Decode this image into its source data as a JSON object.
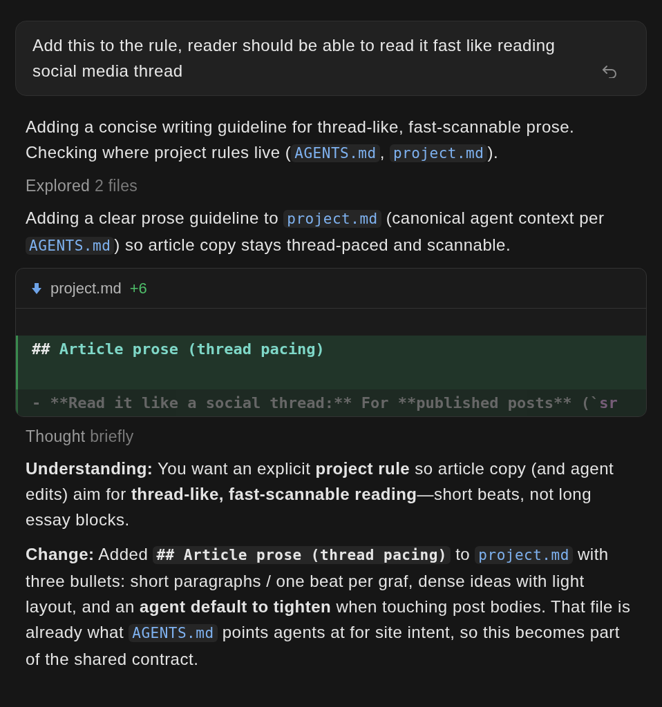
{
  "user_message": {
    "text": "Add this to the rule, reader should be able to read it fast like reading social media thread"
  },
  "blocks": [
    {
      "kind": "paragraph",
      "segments": [
        {
          "kind": "text",
          "text": "Adding a concise writing guideline for thread-like, fast-scannable prose. Checking where project rules live ("
        },
        {
          "kind": "code",
          "text": "AGENTS.md"
        },
        {
          "kind": "text",
          "text": ", "
        },
        {
          "kind": "code",
          "text": "project.md"
        },
        {
          "kind": "text",
          "text": ")."
        }
      ]
    },
    {
      "kind": "status",
      "label": "Explored",
      "detail": "2 files"
    },
    {
      "kind": "paragraph",
      "segments": [
        {
          "kind": "text",
          "text": "Adding a clear prose guideline to "
        },
        {
          "kind": "code",
          "text": "project.md"
        },
        {
          "kind": "text",
          "text": " (canonical agent context per "
        },
        {
          "kind": "code",
          "text": "AGENTS.md"
        },
        {
          "kind": "text",
          "text": ") so article copy stays thread-paced and scannable."
        }
      ]
    },
    {
      "kind": "diff",
      "file": "project.md",
      "added_count": "+6",
      "lines": [
        {
          "added": false
        },
        {
          "added": true,
          "segments": [
            {
              "kind": "marker",
              "text": "## "
            },
            {
              "kind": "heading",
              "text": "Article prose (thread pacing)"
            }
          ]
        },
        {
          "added": true
        },
        {
          "added": true,
          "faded": true,
          "segments": [
            {
              "kind": "plain",
              "text": "- **Read it like a social thread:** For **published posts** (`"
            },
            {
              "kind": "literal",
              "text": "sr"
            }
          ]
        }
      ]
    },
    {
      "kind": "status",
      "label": "Thought",
      "detail": "briefly"
    },
    {
      "kind": "paragraph",
      "segments": [
        {
          "kind": "bold",
          "text": "Understanding:"
        },
        {
          "kind": "text",
          "text": " You want an explicit "
        },
        {
          "kind": "bold",
          "text": "project rule"
        },
        {
          "kind": "text",
          "text": " so article copy (and agent edits) aim for "
        },
        {
          "kind": "bold",
          "text": "thread-like, fast-scannable reading"
        },
        {
          "kind": "text",
          "text": "—short beats, not long essay blocks."
        }
      ]
    },
    {
      "kind": "paragraph",
      "segments": [
        {
          "kind": "bold",
          "text": "Change:"
        },
        {
          "kind": "text",
          "text": " Added "
        },
        {
          "kind": "code_bold",
          "text": "## Article prose (thread pacing)"
        },
        {
          "kind": "text",
          "text": " to "
        },
        {
          "kind": "code",
          "text": "project.md"
        },
        {
          "kind": "text",
          "text": " with three bullets: short paragraphs / one beat per graf, dense ideas with light layout, and an "
        },
        {
          "kind": "bold",
          "text": "agent default to tighten"
        },
        {
          "kind": "text",
          "text": " when touching post bodies. That file is already what "
        },
        {
          "kind": "code",
          "text": "AGENTS.md"
        },
        {
          "kind": "text",
          "text": " points agents at for site intent, so this becomes part of the shared contract."
        }
      ]
    }
  ]
}
